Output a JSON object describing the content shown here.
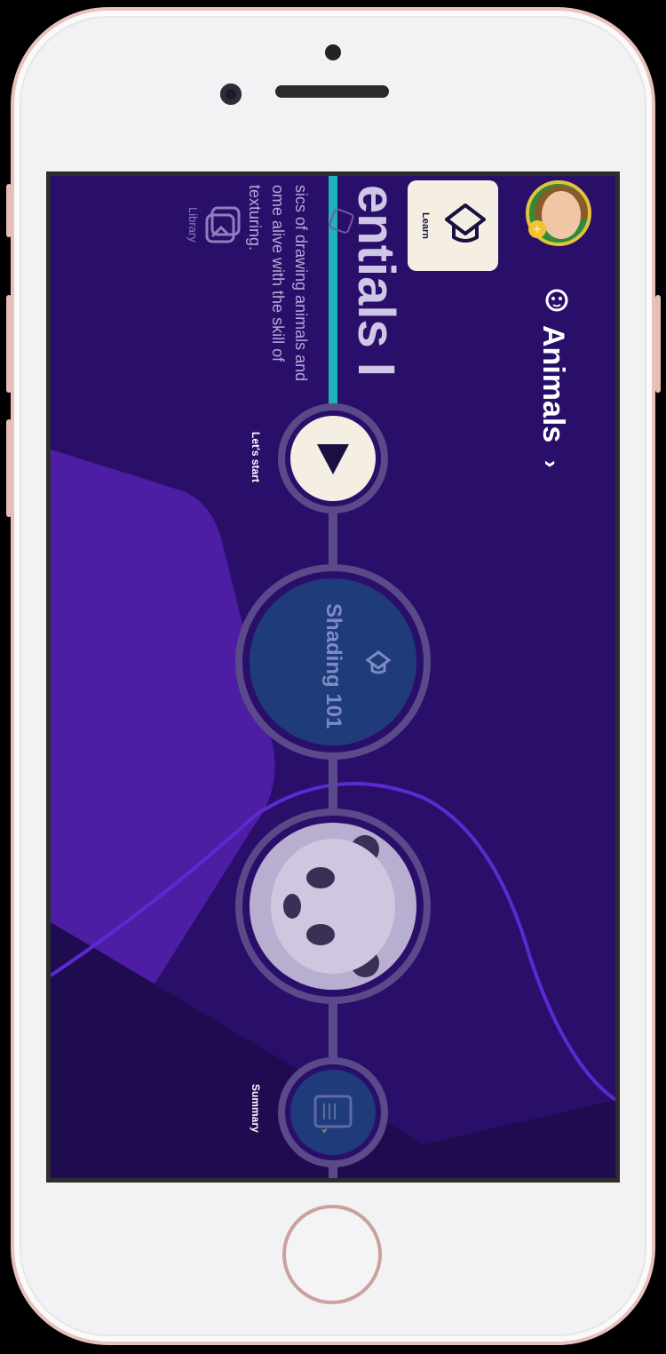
{
  "header": {
    "topic_label": "Animals",
    "topic_icon": "animal-face-icon",
    "chevron_icon": "chevron-down-icon",
    "learn_label": "Learn",
    "learn_icon": "graduation-cap-icon"
  },
  "course": {
    "title": "entials I",
    "description": "sics of drawing animals and ome alive with the skill of texturing."
  },
  "sidebar": {
    "library_label": "Library"
  },
  "path": {
    "start_label": "Let's start",
    "nodes": [
      {
        "label": "Shading 101",
        "icon": "graduation-cap-icon"
      },
      {
        "label": "",
        "icon": "panda-image"
      },
      {
        "label": "",
        "icon": "summary-icon"
      }
    ],
    "summary_label": "Summary"
  },
  "colors": {
    "background": "#2a0f6a",
    "accent_teal": "#1fb3b8",
    "node_ring": "#5a4a8a",
    "node_fill": "#1f3b7a",
    "card": "#f4efe2"
  }
}
